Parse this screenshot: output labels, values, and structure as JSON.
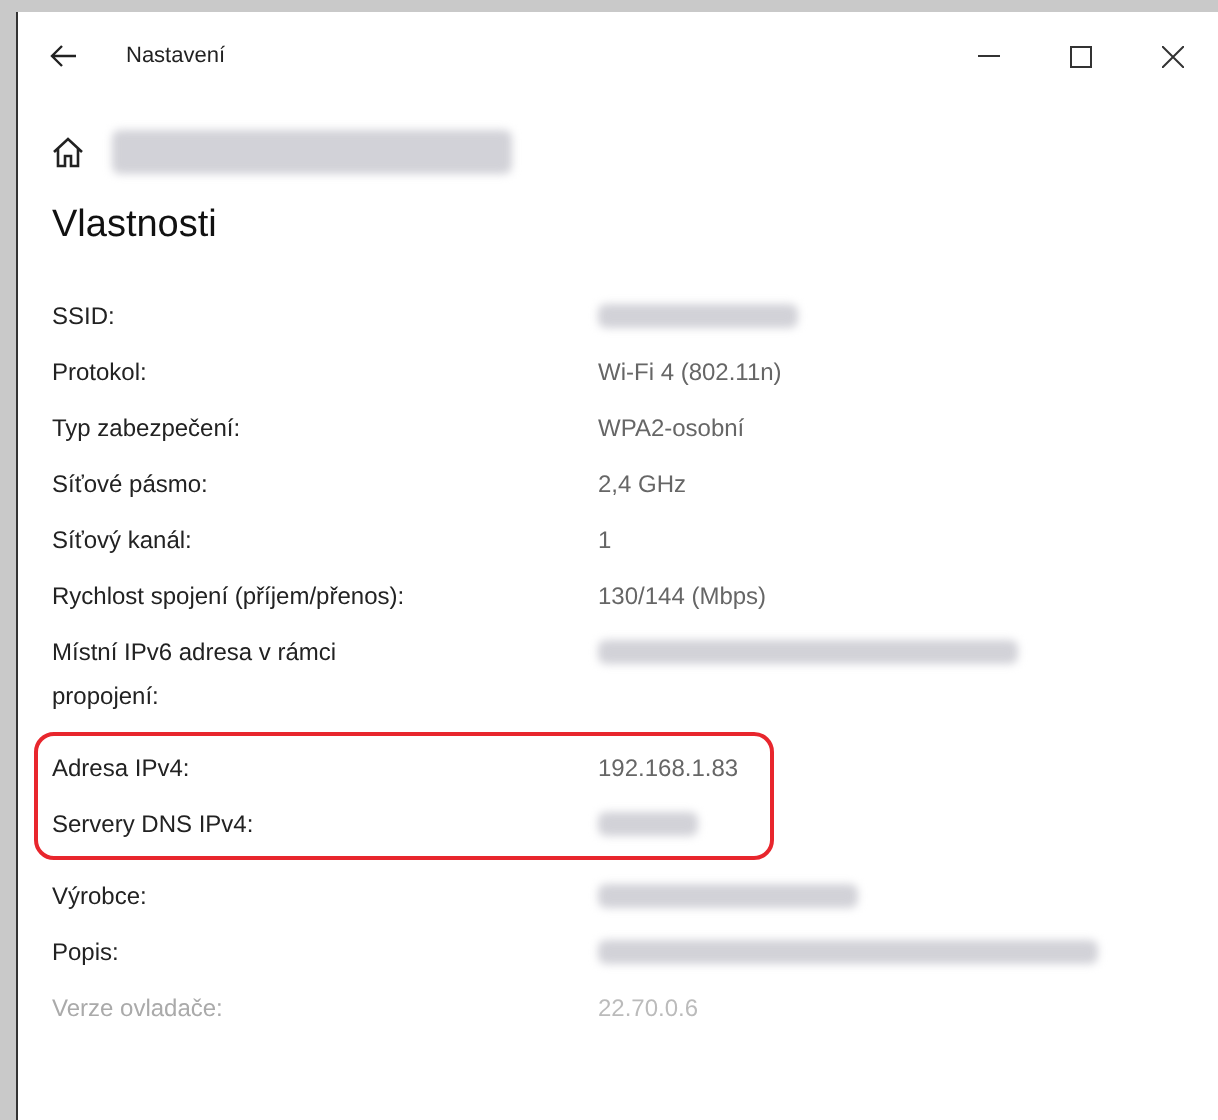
{
  "window": {
    "title": "Nastavení"
  },
  "network": {
    "name_redacted": true
  },
  "section_title": "Vlastnosti",
  "groups": [
    {
      "highlighted": false,
      "rows": [
        {
          "label": "SSID:",
          "redacted": true,
          "dimmed": false
        },
        {
          "label": "Protokol:",
          "value": "Wi-Fi 4 (802.11n)",
          "dimmed": false
        },
        {
          "label": "Typ zabezpečení:",
          "value": "WPA2-osobní",
          "dimmed": false
        },
        {
          "label": "Síťové pásmo:",
          "value": "2,4 GHz",
          "dimmed": false
        },
        {
          "label": "Síťový kanál:",
          "value": "1",
          "dimmed": false
        },
        {
          "label": "Rychlost spojení (příjem/přenos):",
          "value": "130/144 (Mbps)",
          "dimmed": false
        },
        {
          "label": "Místní IPv6 adresa v rámci propojení:",
          "redacted": true,
          "dimmed": false
        }
      ]
    },
    {
      "highlighted": true,
      "rows": [
        {
          "label": "Adresa IPv4:",
          "value": "192.168.1.83",
          "dimmed": false
        },
        {
          "label": "Servery DNS IPv4:",
          "redacted": true,
          "dimmed": false
        }
      ]
    },
    {
      "highlighted": false,
      "rows": [
        {
          "label": "Výrobce:",
          "redacted": true,
          "dimmed": false
        },
        {
          "label": "Popis:",
          "redacted": true,
          "dimmed": false
        },
        {
          "label": "Verze ovladače:",
          "value": "22.70.0.6",
          "dimmed": true
        }
      ]
    }
  ]
}
